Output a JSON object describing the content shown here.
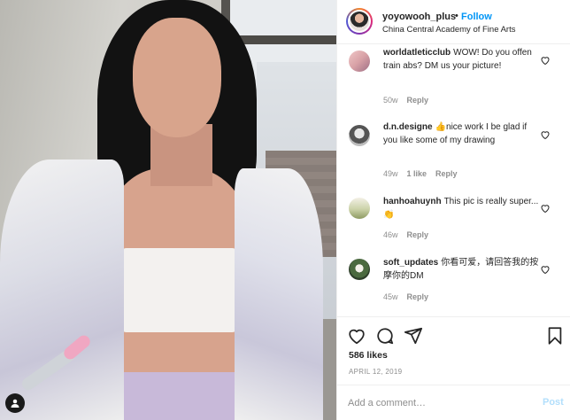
{
  "post": {
    "username": "yoyowooh_plus",
    "separator": "•",
    "follow_label": "Follow",
    "location": "China Central Academy of Fine Arts",
    "likes": "586 likes",
    "date": "APRIL 12, 2019"
  },
  "comments": [
    {
      "user": "worldatleticclub",
      "text": "WOW! Do you offen train abs? DM us your picture!",
      "age": "50w",
      "likes": "",
      "reply": "Reply"
    },
    {
      "user": "d.n.designe",
      "text": "👍nice work I be glad if you like some of my drawing",
      "age": "49w",
      "likes": "1 like",
      "reply": "Reply"
    },
    {
      "user": "hanhoahuynh",
      "text": "This pic is really super... 👏",
      "age": "46w",
      "likes": "",
      "reply": "Reply"
    },
    {
      "user": "soft_updates",
      "text": "你看可爱，请回答我的按摩你的DM",
      "age": "45w",
      "likes": "",
      "reply": "Reply"
    }
  ],
  "composer": {
    "placeholder": "Add a comment…",
    "post_label": "Post"
  },
  "icons": {
    "like": "heart-icon",
    "comment": "comment-icon",
    "share": "share-icon",
    "save": "bookmark-icon",
    "tag": "user-tag-icon"
  },
  "colors": {
    "accent": "#0095f6",
    "post_disabled": "#b2dffc",
    "muted": "#8e8e8e",
    "text": "#262626"
  }
}
